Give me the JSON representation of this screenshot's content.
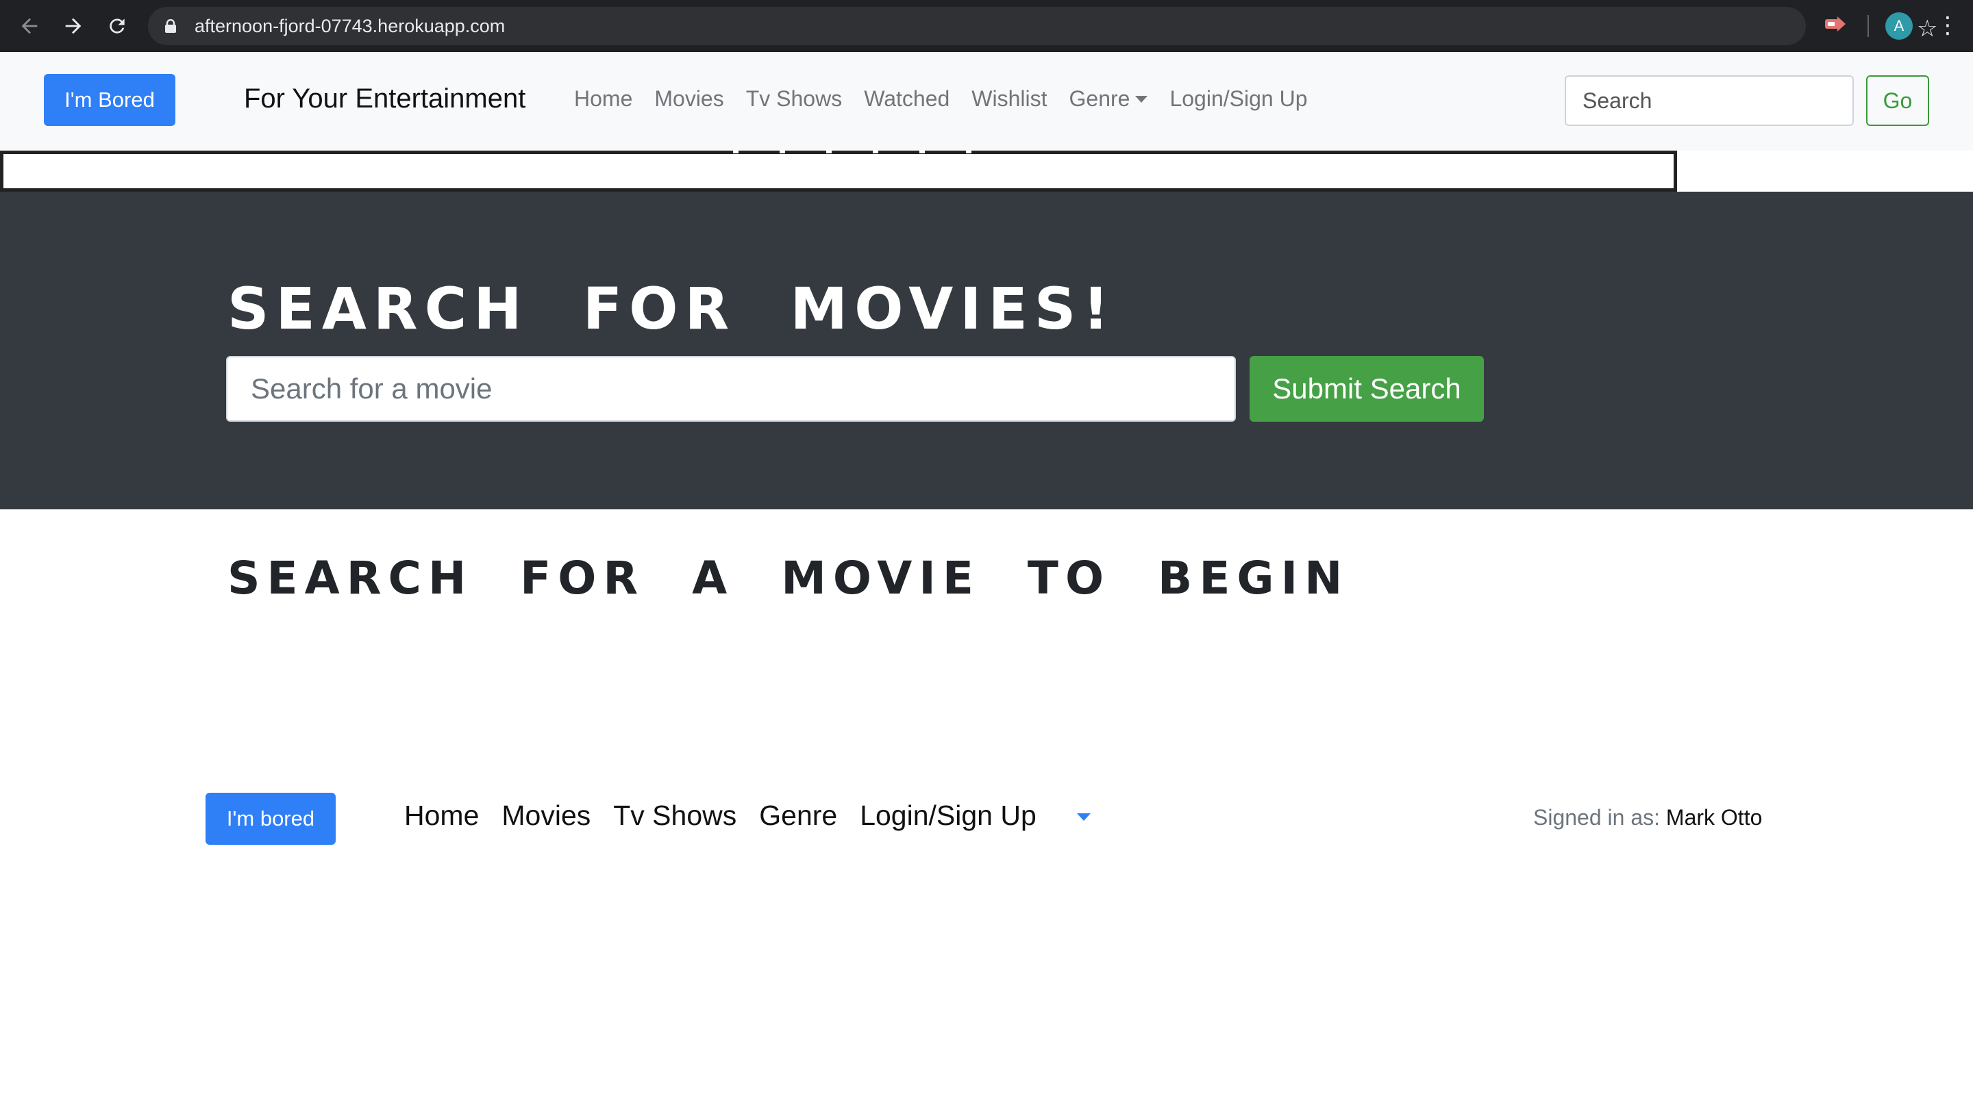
{
  "browser": {
    "url": "afternoon-fjord-07743.herokuapp.com",
    "avatar_letter": "A",
    "icons": [
      "back-arrow-icon",
      "forward-arrow-icon",
      "reload-icon",
      "lock-icon",
      "bookmark-star-icon",
      "extension-icon",
      "profile-avatar",
      "menu-kebab-icon"
    ]
  },
  "topnav": {
    "bored_label": "I'm Bored",
    "brand": "For Your Entertainment",
    "links": [
      "Home",
      "Movies",
      "Tv Shows",
      "Watched",
      "Wishlist",
      "Genre",
      "Login/Sign Up"
    ],
    "search_placeholder": "Search",
    "go_label": "Go"
  },
  "hero": {
    "title": "SEARCH FOR MOVIES!",
    "input_placeholder": "Search for a movie",
    "submit_label": "Submit Search"
  },
  "results": {
    "message": "SEARCH FOR A MOVIE TO BEGIN"
  },
  "bottomnav": {
    "bored_label": "I'm bored",
    "links": [
      "Home",
      "Movies",
      "Tv Shows",
      "Genre",
      "Login/Sign Up"
    ],
    "signed_in_prefix": "Signed in as: ",
    "signed_in_user": "Mark Otto"
  },
  "colors": {
    "primary": "#2f7ff7",
    "success": "#46a046",
    "hero_bg": "#343a40",
    "navbar_bg": "#f8f9fa"
  }
}
